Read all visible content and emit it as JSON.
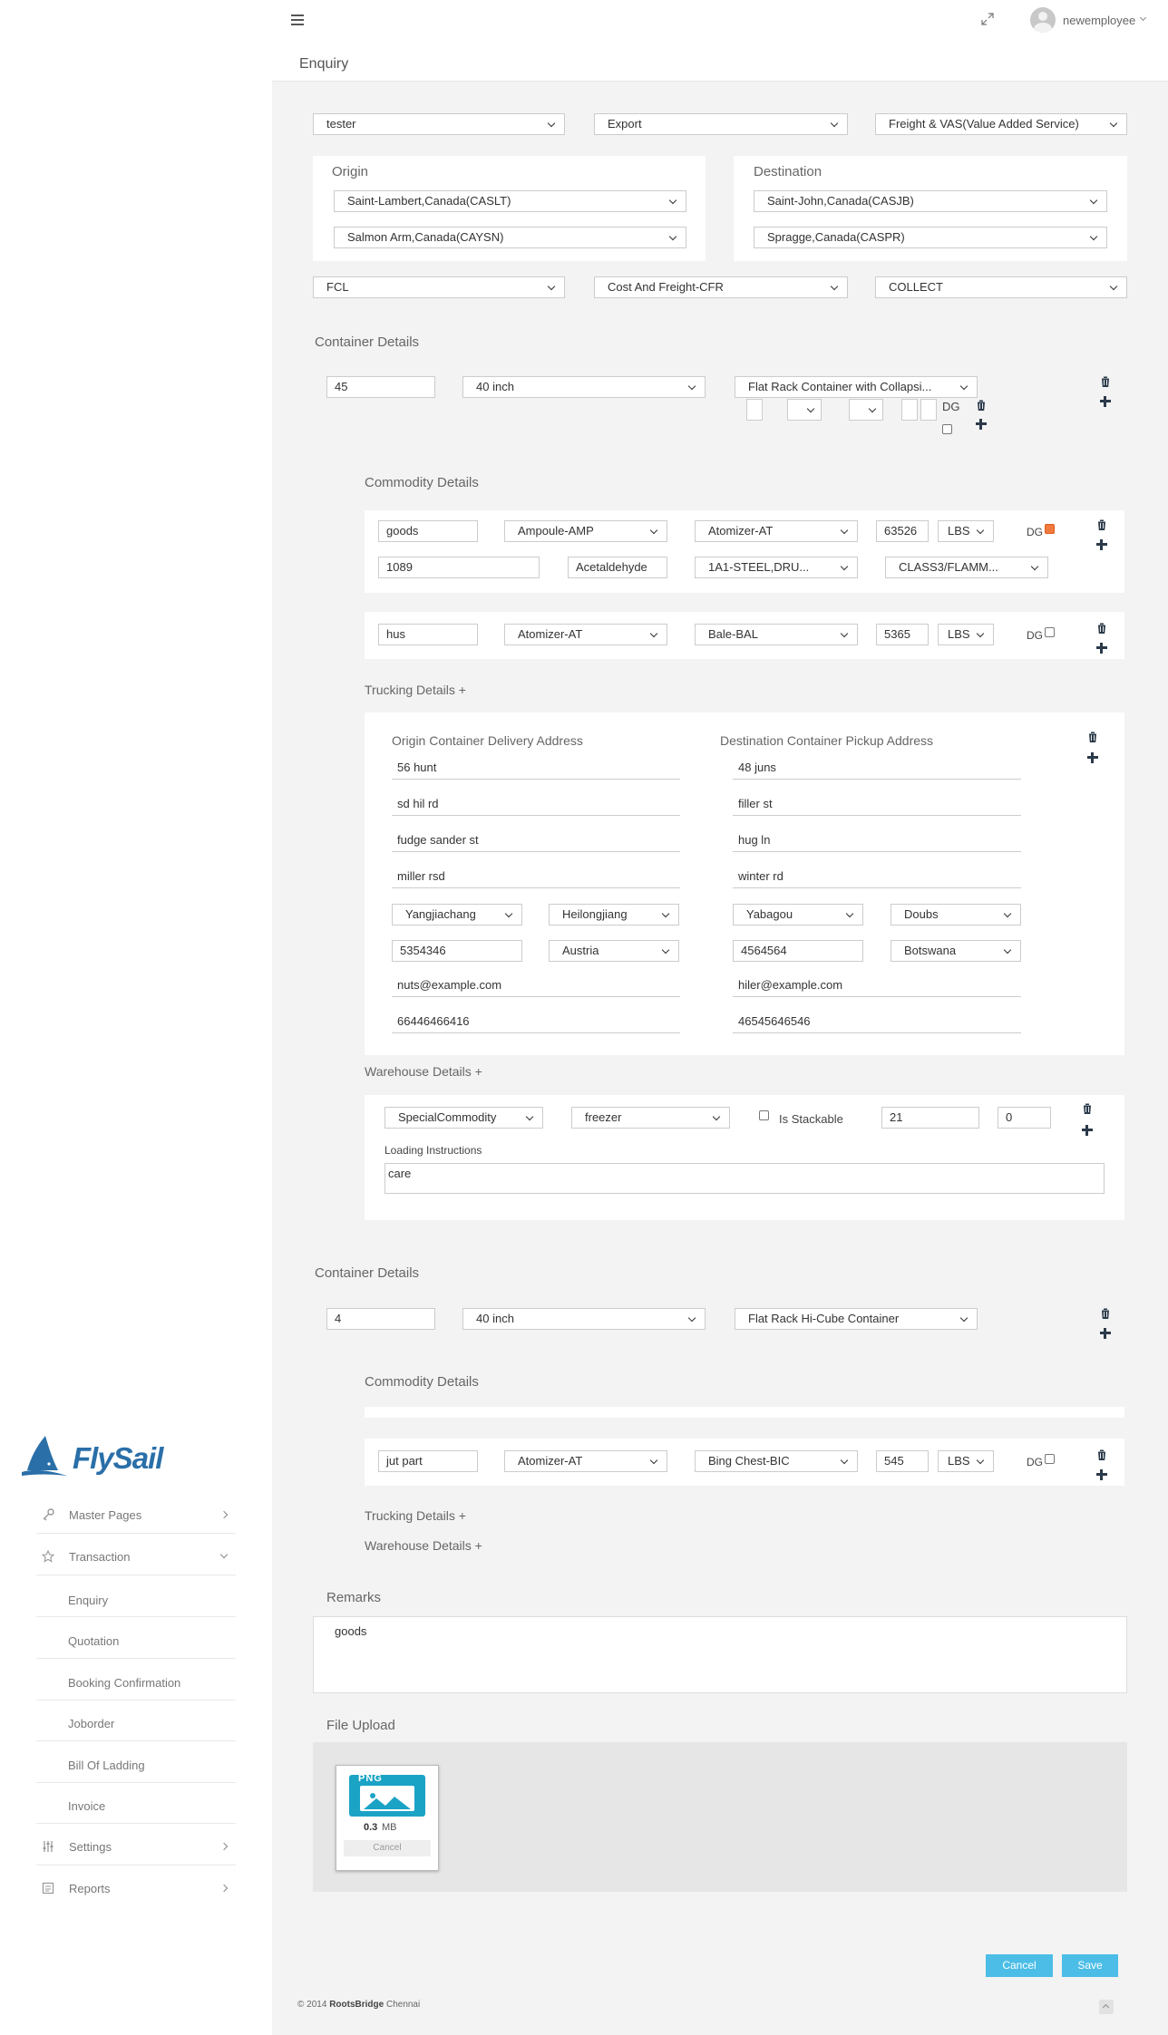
{
  "header": {
    "page_title": "Enquiry",
    "username": "newemployee"
  },
  "brand": {
    "logo_text": "FlySail"
  },
  "sidebar": {
    "items": [
      {
        "label": "Master Pages",
        "icon": "key-icon"
      },
      {
        "label": "Transaction",
        "icon": "star-icon"
      },
      {
        "label": "Enquiry"
      },
      {
        "label": "Quotation"
      },
      {
        "label": "Booking Confirmation"
      },
      {
        "label": "Joborder"
      },
      {
        "label": "Bill Of Ladding"
      },
      {
        "label": "Invoice"
      },
      {
        "label": "Settings",
        "icon": "sliders-icon"
      },
      {
        "label": "Reports",
        "icon": "report-icon"
      }
    ]
  },
  "form": {
    "customer": "tester",
    "trade_type": "Export",
    "service": "Freight & VAS(Value Added Service)",
    "origin": {
      "heading": "Origin",
      "port1": "Saint-Lambert,Canada(CASLT)",
      "port2": "Salmon Arm,Canada(CAYSN)"
    },
    "destination": {
      "heading": "Destination",
      "port1": "Saint-John,Canada(CASJB)",
      "port2": "Spragge,Canada(CASPR)"
    },
    "load_type": "FCL",
    "incoterm": "Cost And Freight-CFR",
    "payment": "COLLECT"
  },
  "containers": [
    {
      "heading": "Container Details",
      "qty": "45",
      "size": "40 inch",
      "type": "Flat Rack Container with Collapsi...",
      "dg_label": "DG",
      "commodity_heading": "Commodity Details",
      "commodities": [
        {
          "name": "goods",
          "package": "Ampoule-AMP",
          "package2": "Atomizer-AT",
          "weight": "63526",
          "unit": "LBS",
          "dg": "DG",
          "un_no": "1089",
          "chemical": "Acetaldehyde",
          "packing": "1A1-STEEL,DRU...",
          "class": "CLASS3/FLAMM..."
        },
        {
          "name": "hus",
          "package": "Atomizer-AT",
          "package2": "Bale-BAL",
          "weight": "5365",
          "unit": "LBS",
          "dg": "DG"
        }
      ],
      "trucking_link": "Trucking Details +",
      "trucking": {
        "origin_heading": "Origin Container Delivery Address",
        "dest_heading": "Destination Container Pickup Address",
        "origin": {
          "line1": "56 hunt",
          "line2": "sd hil rd",
          "line3": "fudge sander st",
          "line4": "miller rsd",
          "city": "Yangjiachang",
          "state": "Heilongjiang",
          "zip": "5354346",
          "country": "Austria",
          "email": "nuts@example.com",
          "phone": "66446466416"
        },
        "dest": {
          "line1": "48 juns",
          "line2": "filler st",
          "line3": "hug ln",
          "line4": "winter rd",
          "city": "Yabagou",
          "state": "Doubs",
          "zip": "4564564",
          "country": "Botswana",
          "email": "hiler@example.com",
          "phone": "46545646546"
        }
      },
      "warehouse_link": "Warehouse Details +",
      "warehouse": {
        "commodity": "SpecialCommodity",
        "storage": "freezer",
        "stackable_label": "Is Stackable",
        "field1": "21",
        "field2": "0",
        "instructions_label": "Loading Instructions",
        "instructions": "care"
      }
    },
    {
      "heading": "Container Details",
      "qty": "4",
      "size": "40 inch",
      "type": "Flat Rack Hi-Cube Container",
      "commodity_heading": "Commodity Details",
      "commodities": [
        {
          "name": "jut part",
          "package": "Atomizer-AT",
          "package2": "Bing Chest-BIC",
          "weight": "545",
          "unit": "LBS",
          "dg": "DG"
        }
      ],
      "trucking_link": "Trucking Details +",
      "warehouse_link": "Warehouse Details +"
    }
  ],
  "remarks": {
    "heading": "Remarks",
    "value": "goods"
  },
  "upload": {
    "heading": "File Upload",
    "badge": "PNG",
    "size_num": "0.3",
    "size_unit": "MB",
    "cancel": "Cancel"
  },
  "actions": {
    "cancel": "Cancel",
    "save": "Save"
  },
  "footer": {
    "year": "© 2014",
    "company": "RootsBridge",
    "city": "Chennai"
  },
  "colors": {
    "accent": "#4bbde6",
    "brand": "#2a6fa8",
    "dg_checked": "#f07a3d"
  }
}
